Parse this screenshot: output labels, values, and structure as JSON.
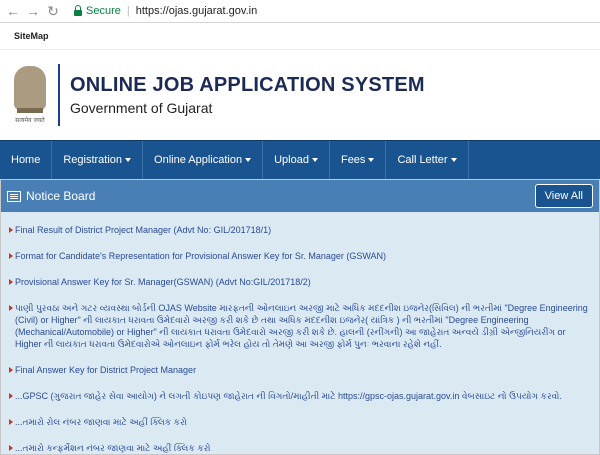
{
  "browser": {
    "secure_label": "Secure",
    "url": "https://ojas.gujarat.gov.in"
  },
  "topbar": {
    "sitemap": "SiteMap"
  },
  "header": {
    "title": "ONLINE JOB APPLICATION SYSTEM",
    "subtitle": "Government of Gujarat",
    "emblem_text": "सत्यमेव जयते"
  },
  "nav": {
    "items": [
      {
        "label": "Home",
        "dropdown": false
      },
      {
        "label": "Registration",
        "dropdown": true
      },
      {
        "label": "Online Application",
        "dropdown": true
      },
      {
        "label": "Upload",
        "dropdown": true
      },
      {
        "label": "Fees",
        "dropdown": true
      },
      {
        "label": "Call Letter",
        "dropdown": true
      }
    ]
  },
  "notice_board": {
    "title": "Notice Board",
    "view_all": "View All",
    "items": [
      "Final Result of District Project Manager (Advt No: GIL/201718/1)",
      "Format for Candidate's Representation for Provisional Answer Key for Sr. Manager (GSWAN)",
      "Provisional Answer Key for Sr. Manager(GSWAN) (Advt No:GIL/201718/2)",
      "પાણી પુરવઠા અને ગટર વ્યવસ્થા બોર્ડની OJAS Website મારફતની ઓનલાઇન અરજી માટે અધિક મદદનીશ ઇજનેર(સિવિલ) ની ભરતીમાં \"Degree Engineering (Civil) or Higher\" ની લાયકાત ધરાવતા ઉમેદવારો અરજી કરી શકે છે તથા અધિક મદદનીશ ઇજનેર( યાંત્રિક ) ની ભરતીમાં \"Degree Engineering (Mechanical/Automobile) or Higher\" ની લાયકાત ધરાવતા ઉમેદવારો અરજી કરી શકે છે. હાલની (રનીંગની) આ જાહેરાત અન્વયે ડીગ્રી એન્જીનિયરીંગ or Higher ની લાયકાત ધરાવતા ઉમેદવારોએ ઓનલાઇન ફોર્મ ભરેલ હોય તો તેમણે આ અરજી ફોર્મ પુનઃ ભરવાના રહેશે નહીં.",
      "Final Answer Key for District Project Manager",
      "...GPSC (ગુજરાત જાહેર સેવા આયોગ) ને લગતી કોઇપણ જાહેરાત ની વિગતો/માહીતી માટે https://gpsc-ojas.gujarat.gov.in વેબસાઇટ નો ઉપયોગ કરવો.",
      "...તમારો રોલ નંબર જાણવા માટે અહીં ક્લિક કરો",
      "...તમારો કન્ફર્મેશન નંબર જાણવા માટે અહીં ક્લિક કરો"
    ]
  }
}
